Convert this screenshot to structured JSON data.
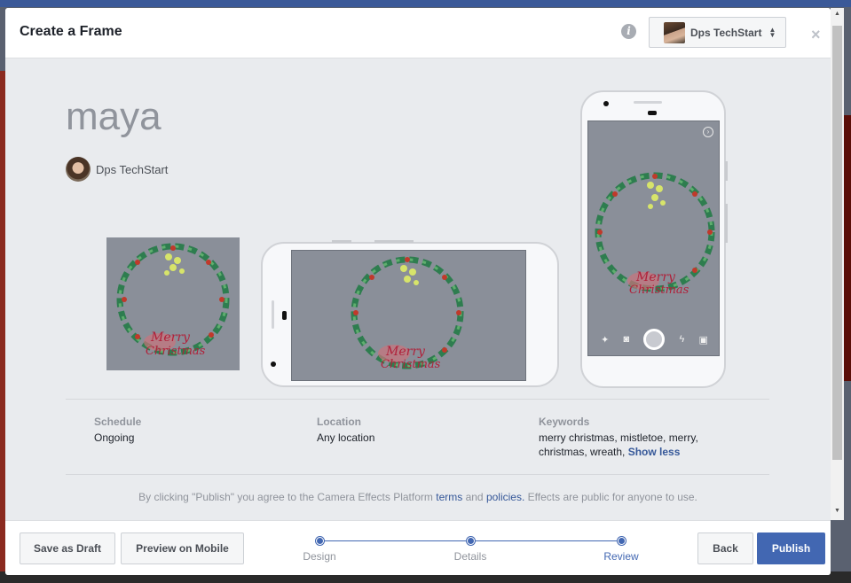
{
  "modal": {
    "title": "Create a Frame",
    "account_name": "Dps TechStart"
  },
  "effect": {
    "name": "maya",
    "creator": "Dps TechStart",
    "overlay_text_line1": "Merry",
    "overlay_text_line2": "Christmas"
  },
  "details": {
    "schedule_label": "Schedule",
    "schedule_value": "Ongoing",
    "location_label": "Location",
    "location_value": "Any location",
    "keywords_label": "Keywords",
    "keywords_value": "merry christmas, mistletoe, merry, christmas, wreath,",
    "show_less": "Show less"
  },
  "terms": {
    "prefix": "By clicking \"Publish\" you agree to the Camera Effects Platform",
    "terms_link": "terms",
    "and": "and",
    "policies_link": "policies.",
    "suffix": "Effects are public for anyone to use."
  },
  "footer": {
    "save_draft": "Save as Draft",
    "preview_mobile": "Preview on Mobile",
    "back": "Back",
    "publish": "Publish",
    "steps": [
      "Design",
      "Details",
      "Review"
    ],
    "active_step": "Review"
  },
  "colors": {
    "accent": "#4267b2",
    "link": "#365899",
    "preview_bg": "#8a8f99"
  }
}
